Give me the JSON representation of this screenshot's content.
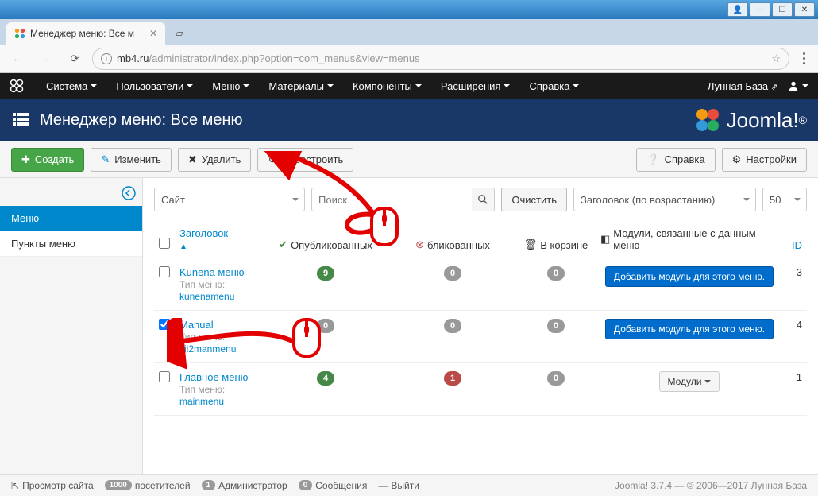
{
  "window": {
    "title_btns": [
      "min",
      "max",
      "restore",
      "close"
    ]
  },
  "browser": {
    "tab_title": "Менеджер меню: Все м",
    "url_domain": "mb4.ru",
    "url_path": "/administrator/index.php?option=com_menus&view=menus"
  },
  "admin_menu": {
    "items": [
      "Система",
      "Пользователи",
      "Меню",
      "Материалы",
      "Компоненты",
      "Расширения",
      "Справка"
    ],
    "site_name": "Лунная База"
  },
  "page": {
    "title": "Менеджер меню: Все меню",
    "logo_text": "Joomla!"
  },
  "toolbar": {
    "create": "Создать",
    "edit": "Изменить",
    "delete": "Удалить",
    "rebuild": "Перестроить",
    "help": "Справка",
    "options": "Настройки"
  },
  "sidebar": {
    "items": [
      "Меню",
      "Пункты меню"
    ]
  },
  "filter": {
    "client": "Сайт",
    "search_placeholder": "Поиск",
    "clear": "Очистить",
    "sort": "Заголовок (по возрастанию)",
    "limit": "50"
  },
  "columns": {
    "title": "Заголовок",
    "published": "Опубликованных",
    "unpublished": "бликованных",
    "trashed": "В корзине",
    "modules": "Модули, связанные с данным меню",
    "id": "ID"
  },
  "rows": [
    {
      "checked": false,
      "title": "Kunena меню",
      "type_label": "Тип меню:",
      "type": "kunenamenu",
      "published": "9",
      "unpublished": "0",
      "trashed": "0",
      "module_btn": "Добавить модуль для этого меню.",
      "module_btn_type": "primary",
      "id": "3"
    },
    {
      "checked": true,
      "title": "Manual",
      "title_prefix": "i 2",
      "type_label": "Тип меню:",
      "type": "yii2manmenu",
      "published": "0",
      "unpublished": "0",
      "trashed": "0",
      "module_btn": "Добавить модуль для этого меню.",
      "module_btn_type": "primary",
      "id": "4"
    },
    {
      "checked": false,
      "title": "Главное меню",
      "type_label": "Тип меню:",
      "type": "mainmenu",
      "published": "4",
      "unpublished": "1",
      "trashed": "0",
      "module_btn": "Модули",
      "module_btn_type": "default",
      "id": "1"
    }
  ],
  "status": {
    "preview": "Просмотр сайта",
    "visitors_count": "1000",
    "visitors": "посетителей",
    "admins_count": "1",
    "admins": "Администратор",
    "messages_count": "0",
    "messages": "Сообщения",
    "logout": "Выйти",
    "version": "Joomla! 3.7.4  —  © 2006—2017 Лунная База"
  }
}
